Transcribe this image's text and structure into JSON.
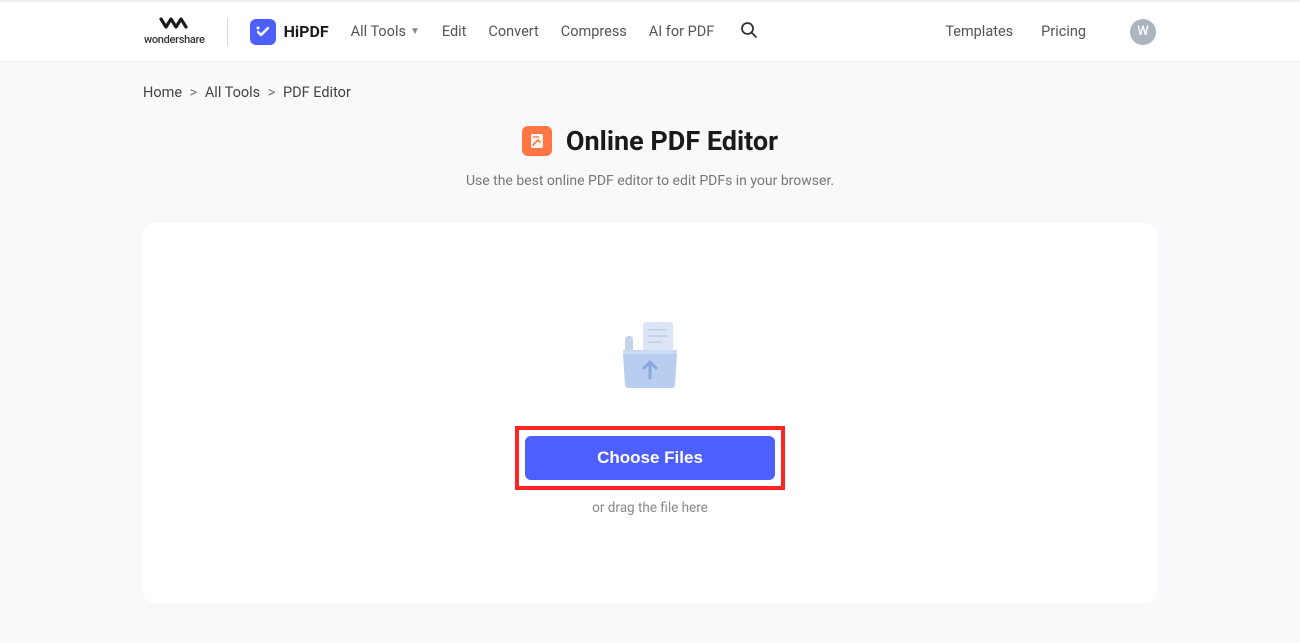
{
  "header": {
    "ws_logo_text": "wondershare",
    "hipdf_label": "HiPDF",
    "nav": {
      "all_tools": "All Tools",
      "edit": "Edit",
      "convert": "Convert",
      "compress": "Compress",
      "ai_pdf": "AI for PDF"
    },
    "templates": "Templates",
    "pricing": "Pricing",
    "avatar_initial": "W"
  },
  "breadcrumb": {
    "home": "Home",
    "all_tools": "All Tools",
    "current": "PDF Editor"
  },
  "page": {
    "title": "Online PDF Editor",
    "subtitle": "Use the best online PDF editor to edit PDFs in your browser.",
    "choose_btn": "Choose Files",
    "drag_hint": "or drag the file here"
  }
}
